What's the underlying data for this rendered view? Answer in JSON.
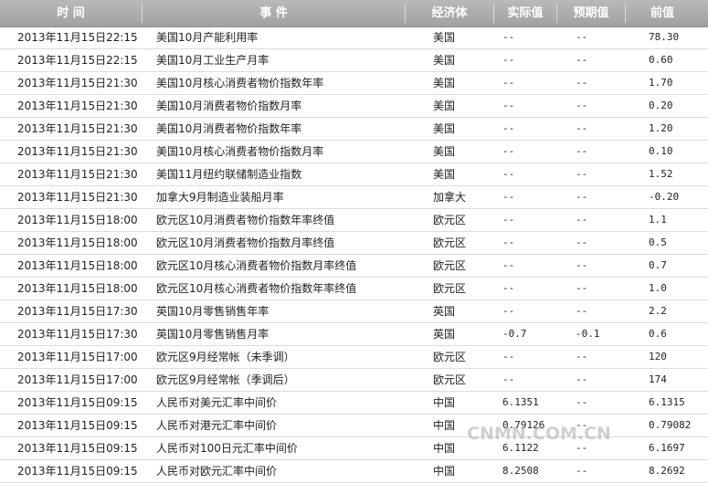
{
  "header": {
    "time": "时 间",
    "event": "事 件",
    "economy": "经济体",
    "actual": "实际值",
    "expected": "预期值",
    "previous": "前值"
  },
  "rows": [
    {
      "time": "2013年11月15日22:15",
      "event": "美国10月产能利用率",
      "economy": "美国",
      "actual": "--",
      "expected": "--",
      "previous": "78.30"
    },
    {
      "time": "2013年11月15日22:15",
      "event": "美国10月工业生产月率",
      "economy": "美国",
      "actual": "--",
      "expected": "--",
      "previous": "0.60"
    },
    {
      "time": "2013年11月15日21:30",
      "event": "美国10月核心消费者物价指数年率",
      "economy": "美国",
      "actual": "--",
      "expected": "--",
      "previous": "1.70"
    },
    {
      "time": "2013年11月15日21:30",
      "event": "美国10月消费者物价指数月率",
      "economy": "美国",
      "actual": "--",
      "expected": "--",
      "previous": "0.20"
    },
    {
      "time": "2013年11月15日21:30",
      "event": "美国10月消费者物价指数年率",
      "economy": "美国",
      "actual": "--",
      "expected": "--",
      "previous": "1.20"
    },
    {
      "time": "2013年11月15日21:30",
      "event": "美国10月核心消费者物价指数月率",
      "economy": "美国",
      "actual": "--",
      "expected": "--",
      "previous": "0.10"
    },
    {
      "time": "2013年11月15日21:30",
      "event": "美国11月纽约联储制造业指数",
      "economy": "美国",
      "actual": "--",
      "expected": "--",
      "previous": "1.52"
    },
    {
      "time": "2013年11月15日21:30",
      "event": "加拿大9月制造业装船月率",
      "economy": "加拿大",
      "actual": "--",
      "expected": "--",
      "previous": "-0.20"
    },
    {
      "time": "2013年11月15日18:00",
      "event": "欧元区10月消费者物价指数年率终值",
      "economy": "欧元区",
      "actual": "--",
      "expected": "--",
      "previous": "1.1"
    },
    {
      "time": "2013年11月15日18:00",
      "event": "欧元区10月消费者物价指数月率终值",
      "economy": "欧元区",
      "actual": "--",
      "expected": "--",
      "previous": "0.5"
    },
    {
      "time": "2013年11月15日18:00",
      "event": "欧元区10月核心消费者物价指数月率终值",
      "economy": "欧元区",
      "actual": "--",
      "expected": "--",
      "previous": "0.7"
    },
    {
      "time": "2013年11月15日18:00",
      "event": "欧元区10月核心消费者物价指数年率终值",
      "economy": "欧元区",
      "actual": "--",
      "expected": "--",
      "previous": "1.0"
    },
    {
      "time": "2013年11月15日17:30",
      "event": "英国10月零售销售年率",
      "economy": "英国",
      "actual": "--",
      "expected": "--",
      "previous": "2.2"
    },
    {
      "time": "2013年11月15日17:30",
      "event": "英国10月零售销售月率",
      "economy": "英国",
      "actual": "-0.7",
      "expected": "-0.1",
      "previous": "0.6"
    },
    {
      "time": "2013年11月15日17:00",
      "event": "欧元区9月经常帐（未季调）",
      "economy": "欧元区",
      "actual": "--",
      "expected": "--",
      "previous": "120"
    },
    {
      "time": "2013年11月15日17:00",
      "event": "欧元区9月经常帐（季调后）",
      "economy": "欧元区",
      "actual": "--",
      "expected": "--",
      "previous": "174"
    },
    {
      "time": "2013年11月15日09:15",
      "event": "人民币对美元汇率中间价",
      "economy": "中国",
      "actual": "6.1351",
      "expected": "--",
      "previous": "6.1315"
    },
    {
      "time": "2013年11月15日09:15",
      "event": "人民币对港元汇率中间价",
      "economy": "中国",
      "actual": "0.79126",
      "expected": "--",
      "previous": "0.79082"
    },
    {
      "time": "2013年11月15日09:15",
      "event": "人民币对100日元汇率中间价",
      "economy": "中国",
      "actual": "6.1122",
      "expected": "--",
      "previous": "6.1697"
    },
    {
      "time": "2013年11月15日09:15",
      "event": "人民币对欧元汇率中间价",
      "economy": "中国",
      "actual": "8.2508",
      "expected": "--",
      "previous": "8.2692"
    }
  ],
  "watermark": "CNMN.COM.CN"
}
